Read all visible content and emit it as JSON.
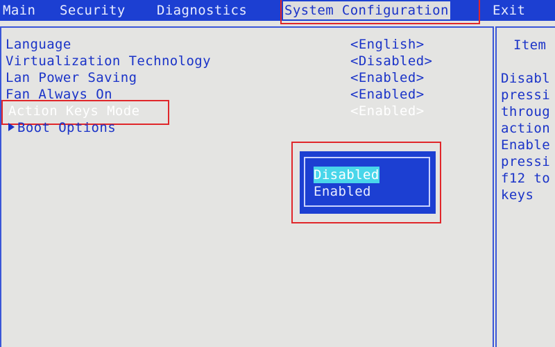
{
  "menu": {
    "items": [
      {
        "label": "Main"
      },
      {
        "label": "Security"
      },
      {
        "label": "Diagnostics"
      },
      {
        "label": "System Configuration"
      },
      {
        "label": "Exit"
      }
    ],
    "active_index": 3
  },
  "settings": [
    {
      "name": "Language",
      "value": "<English>"
    },
    {
      "name": "Virtualization Technology",
      "value": "<Disabled>"
    },
    {
      "name": "Lan Power Saving",
      "value": "<Enabled>"
    },
    {
      "name": "Fan Always On",
      "value": "<Enabled>"
    },
    {
      "name": "Action Keys Mode",
      "value": "<Enabled>"
    },
    {
      "name": "Boot Options",
      "value": ""
    }
  ],
  "popup": {
    "options": [
      "Disabled",
      "Enabled"
    ],
    "selected": "Disabled"
  },
  "help": {
    "title": "Item",
    "lines": [
      "Disabl",
      "pressi",
      "throug",
      "action",
      "Enable",
      "pressi",
      "f12 to",
      "keys"
    ]
  },
  "colors": {
    "bar_blue": "#1c3fd2",
    "text_blue": "#1a33c8",
    "background": "#e4e4e2",
    "annotation_red": "#e0262a",
    "selection_cyan": "#49d6ea"
  }
}
